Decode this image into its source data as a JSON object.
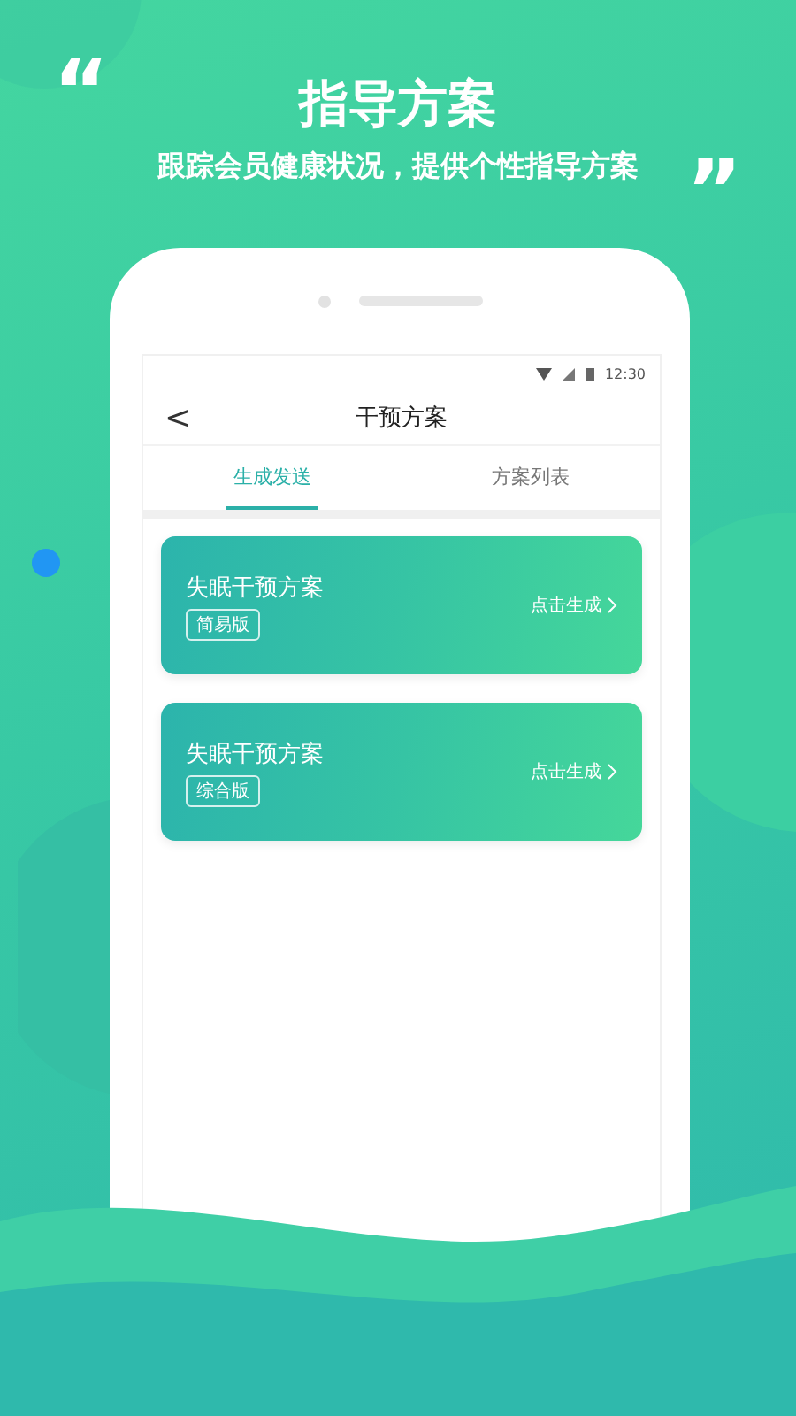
{
  "banner": {
    "open_quote": "“",
    "title": "指导方案",
    "subtitle": "跟踪会员健康状况，提供个性指导方案",
    "close_quote": "”"
  },
  "status_bar": {
    "time": "12:30"
  },
  "header": {
    "back": "<",
    "title": "干预方案"
  },
  "tabs": [
    {
      "label": "生成发送",
      "selected": true
    },
    {
      "label": "方案列表",
      "selected": false
    }
  ],
  "cards": [
    {
      "title": "失眠干预方案",
      "badge": "简易版",
      "action": "点击生成"
    },
    {
      "title": "失眠干预方案",
      "badge": "综合版",
      "action": "点击生成"
    }
  ]
}
